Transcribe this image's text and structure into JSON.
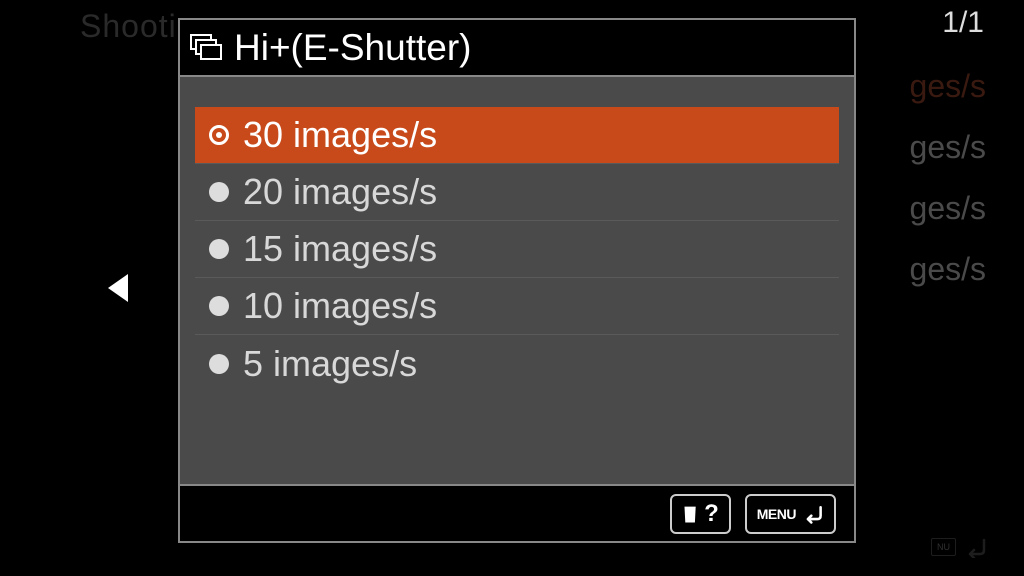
{
  "background": {
    "top_text": "Shooti",
    "page_indicator": "1/1",
    "side_values": [
      "ges/s",
      "ges/s",
      "ges/s",
      "ges/s"
    ],
    "menu_label": "NU"
  },
  "dialog": {
    "title": "Hi+(E-Shutter)",
    "options": [
      {
        "label": "30 images/s",
        "selected": true
      },
      {
        "label": "20 images/s",
        "selected": false
      },
      {
        "label": "15 images/s",
        "selected": false
      },
      {
        "label": "10 images/s",
        "selected": false
      },
      {
        "label": "5 images/s",
        "selected": false
      }
    ],
    "footer": {
      "help_symbol": "?",
      "menu_label": "MENU"
    }
  }
}
